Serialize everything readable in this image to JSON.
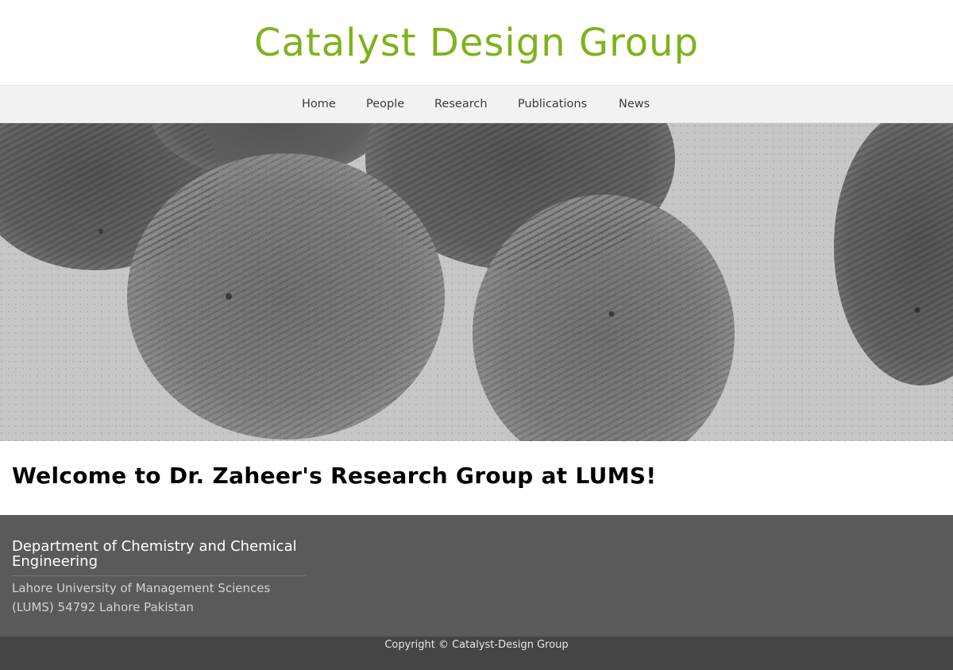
{
  "header": {
    "site_title": "Catalyst Design Group",
    "title_color": "#7fb21c"
  },
  "nav": {
    "items": [
      {
        "label": "Home"
      },
      {
        "label": "People"
      },
      {
        "label": "Research"
      },
      {
        "label": "Publications"
      },
      {
        "label": "News"
      }
    ]
  },
  "hero": {
    "image": "electron-microscope-image-of-mesoporous-nanoparticles"
  },
  "main": {
    "welcome_title": "Welcome to Dr. Zaheer's Research Group at LUMS!"
  },
  "footer": {
    "department_title": "Department of Chemistry and Chemical Engineering",
    "address": "Lahore University of Management Sciences (LUMS) 54792 Lahore Pakistan",
    "copyright": "Copyright © Catalyst-Design Group",
    "background_color": "#5a5a5a",
    "bottom_bar_color": "#454545"
  }
}
